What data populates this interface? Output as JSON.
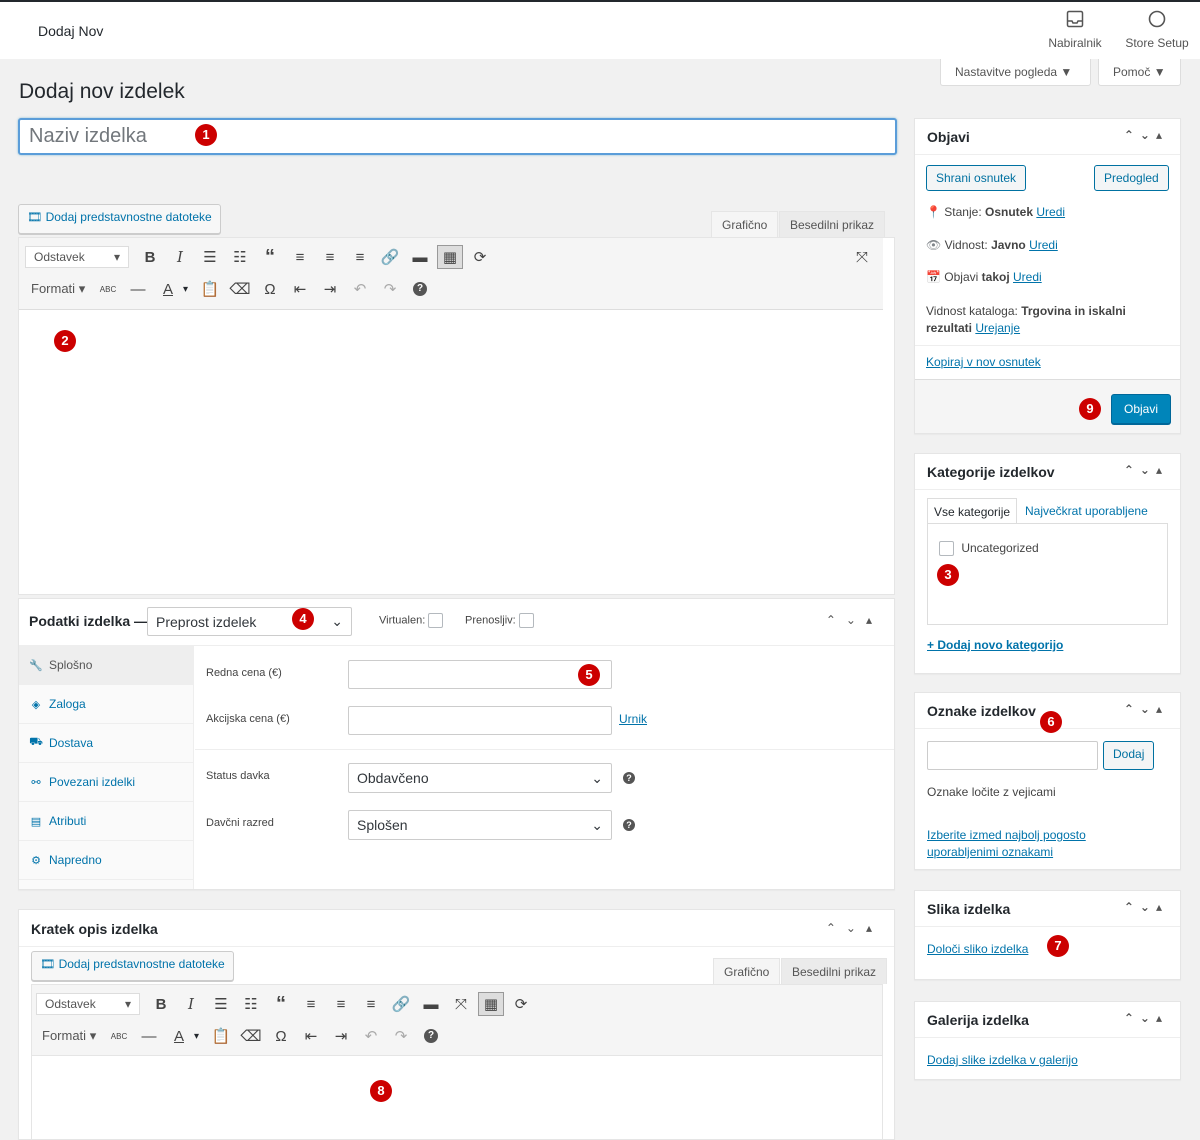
{
  "topbar": {
    "title": "Dodaj Nov",
    "inbox_label": "Nabiralnik",
    "store_setup_label": "Store Setup"
  },
  "screen_options_label": "Nastavitve pogleda",
  "help_label": "Pomoč",
  "page_title": "Dodaj nov izdelek",
  "title_placeholder": "Naziv izdelka",
  "badges": [
    "1",
    "2",
    "3",
    "4",
    "5",
    "6",
    "7",
    "8",
    "9"
  ],
  "editor": {
    "add_media_label": "Dodaj predstavnostne datoteke",
    "tab_visual": "Grafično",
    "tab_text": "Besedilni prikaz",
    "format_select": "Odstavek",
    "formats_label": "Formati"
  },
  "product_data": {
    "title": "Podatki izdelka —",
    "type_value": "Preprost izdelek",
    "virtual_label": "Virtualen:",
    "downloadable_label": "Prenosljiv:",
    "tabs": [
      {
        "label": "Splošno",
        "icon": "wrench-icon"
      },
      {
        "label": "Zaloga",
        "icon": "tag-icon"
      },
      {
        "label": "Dostava",
        "icon": "truck-icon"
      },
      {
        "label": "Povezani izdelki",
        "icon": "link-icon"
      },
      {
        "label": "Atributi",
        "icon": "list-icon"
      },
      {
        "label": "Napredno",
        "icon": "gear-icon"
      }
    ],
    "regular_price_label": "Redna cena (€)",
    "sale_price_label": "Akcijska cena (€)",
    "schedule_link": "Urnik",
    "tax_status_label": "Status davka",
    "tax_status_value": "Obdavčeno",
    "tax_class_label": "Davčni razred",
    "tax_class_value": "Splošen"
  },
  "short_description": {
    "title": "Kratek opis izdelka"
  },
  "publish": {
    "title": "Objavi",
    "save_draft": "Shrani osnutek",
    "preview": "Predogled",
    "status_label": "Stanje: ",
    "status_value": "Osnutek",
    "visibility_label": "Vidnost: ",
    "visibility_value": "Javno",
    "publish_label": "Objavi ",
    "publish_value": "takoj",
    "edit_link": "Uredi",
    "catalog_label": "Vidnost kataloga: ",
    "catalog_value": "Trgovina in iskalni rezultati",
    "catalog_edit": "Urejanje",
    "copy_draft": "Kopiraj v nov osnutek",
    "publish_button": "Objavi"
  },
  "categories": {
    "title": "Kategorije izdelkov",
    "tab_all": "Vse kategorije",
    "tab_popular": "Največkrat uporabljene",
    "item": "Uncategorized",
    "add_new": "+ Dodaj novo kategorijo"
  },
  "tags": {
    "title": "Oznake izdelkov",
    "add_button": "Dodaj",
    "hint": "Oznake ločite z vejicami",
    "choose_link": "Izberite izmed najbolj pogosto uporabljenimi oznakami"
  },
  "product_image": {
    "title": "Slika izdelka",
    "set_link": "Določi sliko izdelka"
  },
  "gallery": {
    "title": "Galerija izdelka",
    "add_link": "Dodaj slike izdelka v galerijo"
  }
}
